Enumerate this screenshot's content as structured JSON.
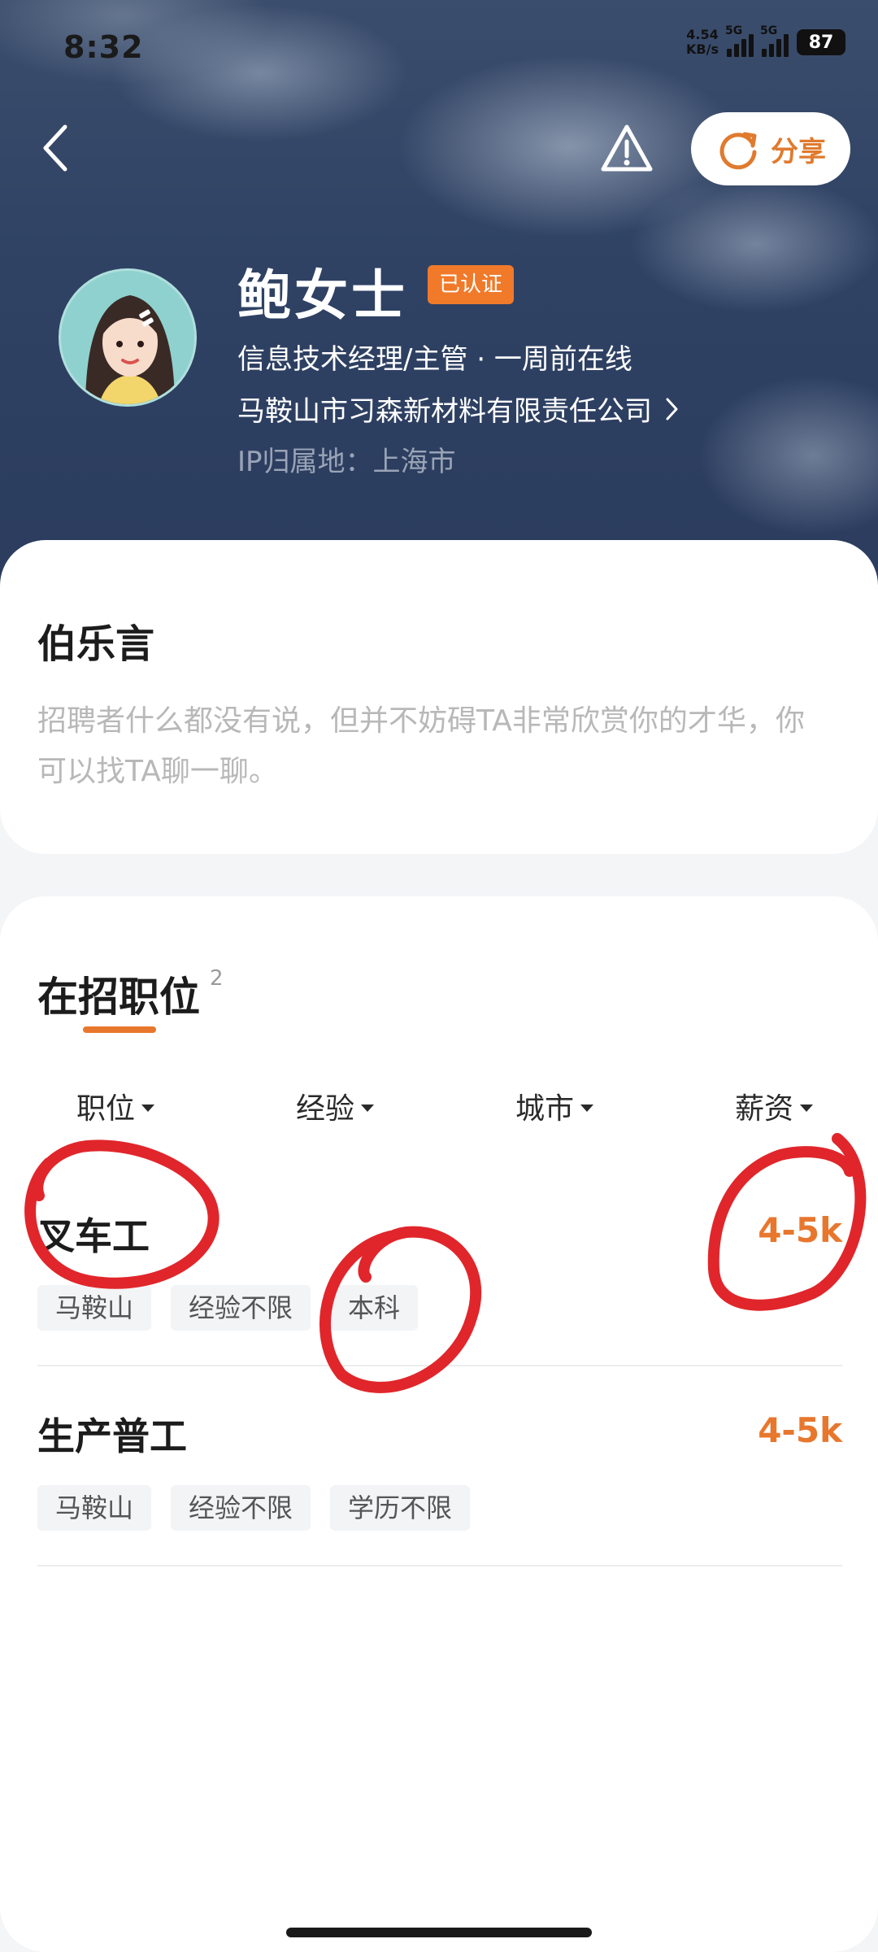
{
  "status_bar": {
    "time": "8:32",
    "net_speed_top": "4.54",
    "net_speed_bottom": "KB/s",
    "sim1_label": "5G",
    "sim2_label": "5G",
    "battery": "87"
  },
  "nav": {
    "share_label": "分享"
  },
  "profile": {
    "name": "鲍女士",
    "verified_badge": "已认证",
    "title_status": "信息技术经理/主管 · 一周前在线",
    "company": "马鞍山市习森新材料有限责任公司",
    "ip_location": "IP归属地：上海市"
  },
  "about": {
    "title": "伯乐言",
    "text": "招聘者什么都没有说，但并不妨碍TA非常欣赏你的才华，你可以找TA聊一聊。"
  },
  "jobs": {
    "title": "在招职位",
    "count": "2",
    "filters": [
      {
        "label": "职位"
      },
      {
        "label": "经验"
      },
      {
        "label": "城市"
      },
      {
        "label": "薪资"
      }
    ],
    "items": [
      {
        "name": "叉车工",
        "salary": "4-5k",
        "tags": [
          "马鞍山",
          "经验不限",
          "本科"
        ]
      },
      {
        "name": "生产普工",
        "salary": "4-5k",
        "tags": [
          "马鞍山",
          "经验不限",
          "学历不限"
        ]
      }
    ]
  },
  "colors": {
    "accent": "#e8772e",
    "badge": "#f07a2a",
    "annotation": "#e0262b"
  }
}
